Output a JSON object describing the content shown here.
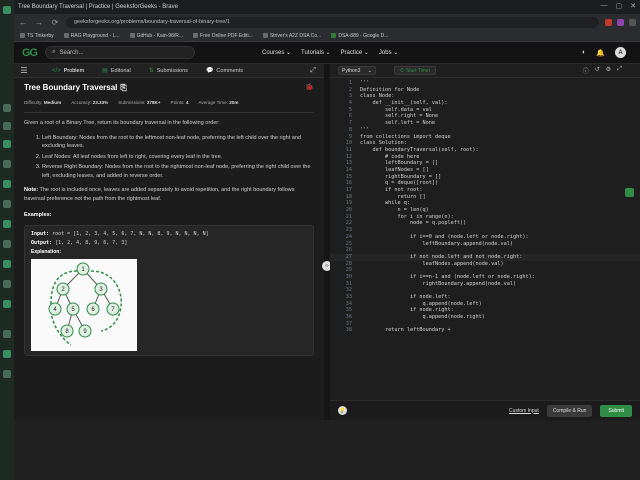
{
  "window": {
    "title": "Tree Boundary Traversal | Practice | GeeksforGeeks - Brave",
    "controls": [
      "—",
      "▢",
      "✕"
    ]
  },
  "toolbar": {
    "url": "geeksforgeeks.org/problems/boundary-traversal-of-binary-tree/1",
    "back": "←",
    "forward": "→",
    "reload": "⟳"
  },
  "bookmarks": [
    "TS Tinkerby",
    "RAG Playground - L...",
    "GitHub - Kain-98/R...",
    "Free Online PDF Editi...",
    "Striver's A2Z DSA Co...",
    "DSA-889 - Google D..."
  ],
  "gfg": {
    "logo": "GG",
    "search_placeholder": "Search...",
    "nav": [
      "Courses ⌄",
      "Tutorials ⌄",
      "Practice ⌄",
      "Jobs ⌄"
    ],
    "avatar": "A"
  },
  "tabs": {
    "problem": "Problem",
    "editorial": "Editorial",
    "submissions": "Submissions",
    "comments": "Comments"
  },
  "problem": {
    "title": "Tree Boundary Traversal",
    "difficulty_label": "Difficulty:",
    "difficulty": "Medium",
    "accuracy_label": "Accuracy:",
    "accuracy": "23.33%",
    "submissions_label": "Submissions:",
    "submissions": "378K+",
    "points_label": "Points:",
    "points": "4",
    "time_label": "Average Time:",
    "time": "20m",
    "description": "Given a root of a Binary Tree, return its boundary traversal in the following order:",
    "steps": [
      "Left Boundary: Nodes from the root to the leftmost non-leaf node, preferring the left child over the right and excluding leaves.",
      "Leaf Nodes: All leaf nodes from left to right, covering every leaf in the tree.",
      "Reverse Right Boundary: Nodes from the root to the rightmost non-leaf node, preferring the right child over the left, excluding leaves, and added in reverse order."
    ],
    "note_label": "Note:",
    "note": "The root is included once, leaves are added separately to avoid repetition, and the right boundary follows traversal preference not the path from the rightmost leaf.",
    "examples_label": "Examples:",
    "input_label": "Input:",
    "input": "root = [1, 2, 3, 4, 5, 6, 7, N, N, 8, 9, N, N, N, N]",
    "output_label": "Output:",
    "output": "[1, 2, 4, 8, 9, 6, 7, 3]",
    "explanation_label": "Explanation:",
    "tree_nodes": [
      "1",
      "2",
      "3",
      "4",
      "5",
      "6",
      "7",
      "8",
      "9"
    ]
  },
  "editor": {
    "language": "Python3",
    "timer": "Start Timer",
    "lines": [
      "'''",
      "Definition for Node",
      "class Node:",
      "    def __init__(self, val):",
      "        self.data = val",
      "        self.right = None",
      "        self.left = None",
      "'''",
      "from collections import deque",
      "class Solution:",
      "    def boundaryTraversal(self, root):",
      "        # code here",
      "        leftBoundary = []",
      "        leafNodes = []",
      "        rightBoundary = []",
      "        q = deque([root])",
      "        if not root:",
      "            return []",
      "        while q:",
      "            n = len(q)",
      "            for i in range(n):",
      "                node = q.popleft()",
      "",
      "                if i==0 and (node.left or node.right):",
      "                    leftBoundary.append(node.val)",
      "",
      "                if not node.left and not node.right:",
      "                    leafNodes.append(node.val)",
      "",
      "                if i==n-1 and (node.left or node.right):",
      "                    rightBoundary.append(node.val)",
      "",
      "                if node.left:",
      "                    q.append(node.left)",
      "                if node.right:",
      "                    q.append(node.right)",
      "",
      "        return leftBoundary +"
    ],
    "highlight_line": 27,
    "custom_input": "Custom Input",
    "compile_run": "Compile & Run",
    "submit": "Submit"
  }
}
